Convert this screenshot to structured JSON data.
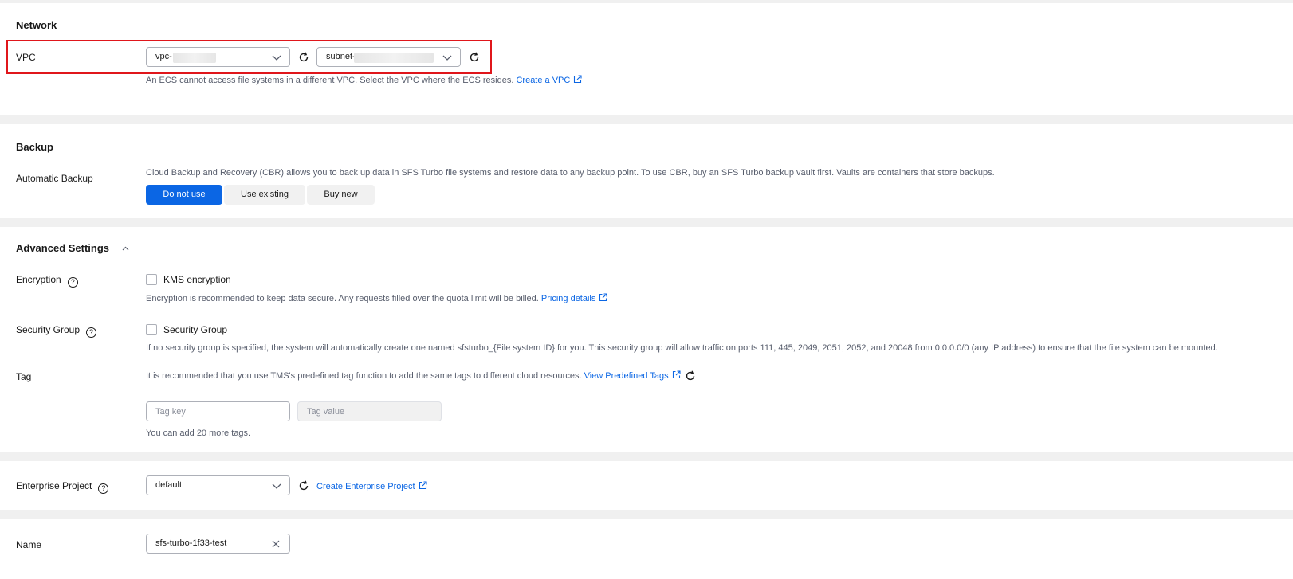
{
  "network": {
    "title": "Network",
    "vpc_label": "VPC",
    "vpc_value": "vpc-",
    "subnet_value": "subnet-",
    "hint": "An ECS cannot access file systems in a different VPC. Select the VPC where the ECS resides.",
    "create_vpc_link": "Create a VPC"
  },
  "backup": {
    "title": "Backup",
    "label": "Automatic Backup",
    "description": "Cloud Backup and Recovery (CBR) allows you to back up data in SFS Turbo file systems and restore data to any backup point. To use CBR, buy an SFS Turbo backup vault first. Vaults are containers that store backups.",
    "options": [
      "Do not use",
      "Use existing",
      "Buy new"
    ],
    "selected": "Do not use"
  },
  "advanced": {
    "title": "Advanced Settings",
    "encryption_label": "Encryption",
    "encryption_checkbox": "KMS encryption",
    "encryption_hint": "Encryption is recommended to keep data secure. Any requests filled over the quota limit will be billed.",
    "pricing_link": "Pricing details",
    "security_group_label": "Security Group",
    "security_group_checkbox": "Security Group",
    "security_group_hint": "If no security group is specified, the system will automatically create one named sfsturbo_{File system ID} for you. This security group will allow traffic on ports 111, 445, 2049, 2051, 2052, and 20048 from 0.0.0.0/0 (any IP address) to ensure that the file system can be mounted.",
    "tag_label": "Tag",
    "tag_hint": "It is recommended that you use TMS's predefined tag function to add the same tags to different cloud resources.",
    "view_tags_link": "View Predefined Tags",
    "tag_key_placeholder": "Tag key",
    "tag_value_placeholder": "Tag value",
    "tag_remaining": "You can add 20 more tags."
  },
  "enterprise": {
    "label": "Enterprise Project",
    "value": "default",
    "create_link": "Create Enterprise Project"
  },
  "name": {
    "label": "Name",
    "value": "sfs-turbo-1f33-test"
  },
  "colors": {
    "accent": "#0b66e4",
    "highlight": "#e0161b"
  }
}
